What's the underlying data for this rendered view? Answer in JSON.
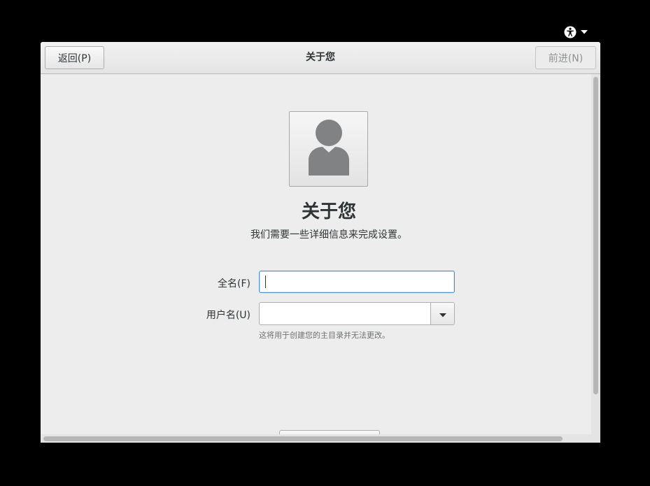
{
  "window": {
    "title": "关于您",
    "back_label": "返回(P)",
    "next_label": "前进(N)"
  },
  "topbar": {
    "accessibility_icon": "accessibility-icon",
    "menu_icon": "chevron-down-icon"
  },
  "page": {
    "avatar_icon": "user-avatar-icon",
    "heading": "关于您",
    "subtitle": "我们需要一些详细信息来完成设置。"
  },
  "form": {
    "full_name_label": "全名(F)",
    "full_name_value": "",
    "username_label": "用户名(U)",
    "username_value": "",
    "username_hint": "这将用于创建您的主目录并无法更改。"
  },
  "colors": {
    "focus_border": "#4a90d9",
    "background": "#ededed",
    "text": "#2e3436"
  }
}
